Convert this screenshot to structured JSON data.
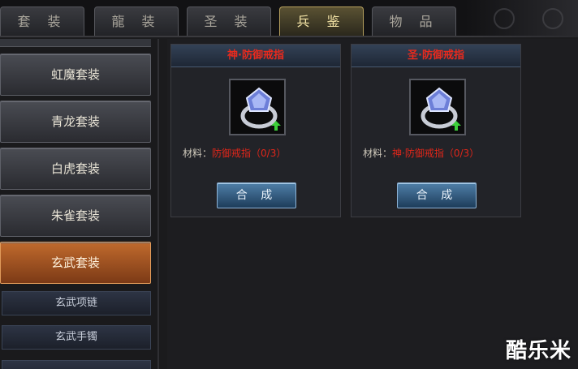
{
  "tabs": [
    {
      "label": "套 装",
      "active": false
    },
    {
      "label": "龍 装",
      "active": false
    },
    {
      "label": "圣 装",
      "active": false
    },
    {
      "label": "兵 鉴",
      "active": true
    },
    {
      "label": "物 品",
      "active": false
    }
  ],
  "sets": [
    {
      "label": "虹魔套装",
      "active": false
    },
    {
      "label": "青龙套装",
      "active": false
    },
    {
      "label": "白虎套装",
      "active": false
    },
    {
      "label": "朱雀套装",
      "active": false
    },
    {
      "label": "玄武套装",
      "active": true
    }
  ],
  "sub_items": [
    "玄武项链",
    "玄武手镯"
  ],
  "cards": [
    {
      "title": "神·防御戒指",
      "materials_label": "材料：",
      "materials_req": "防御戒指（0/3）",
      "combine_label": "合 成",
      "icon": "ring-icon",
      "upgrade_icon": "green-up-arrow-icon"
    },
    {
      "title": "圣·防御戒指",
      "materials_label": "材料：",
      "materials_req": "神·防御戒指（0/3）",
      "combine_label": "合 成",
      "icon": "ring-icon",
      "upgrade_icon": "green-up-arrow-icon"
    }
  ],
  "watermark": "酷乐米",
  "colors": {
    "active_tab": "#b7a15e",
    "active_set": "#c06a2d",
    "title_red": "#e82a1e",
    "combine_blue": "#4f7fa8"
  }
}
